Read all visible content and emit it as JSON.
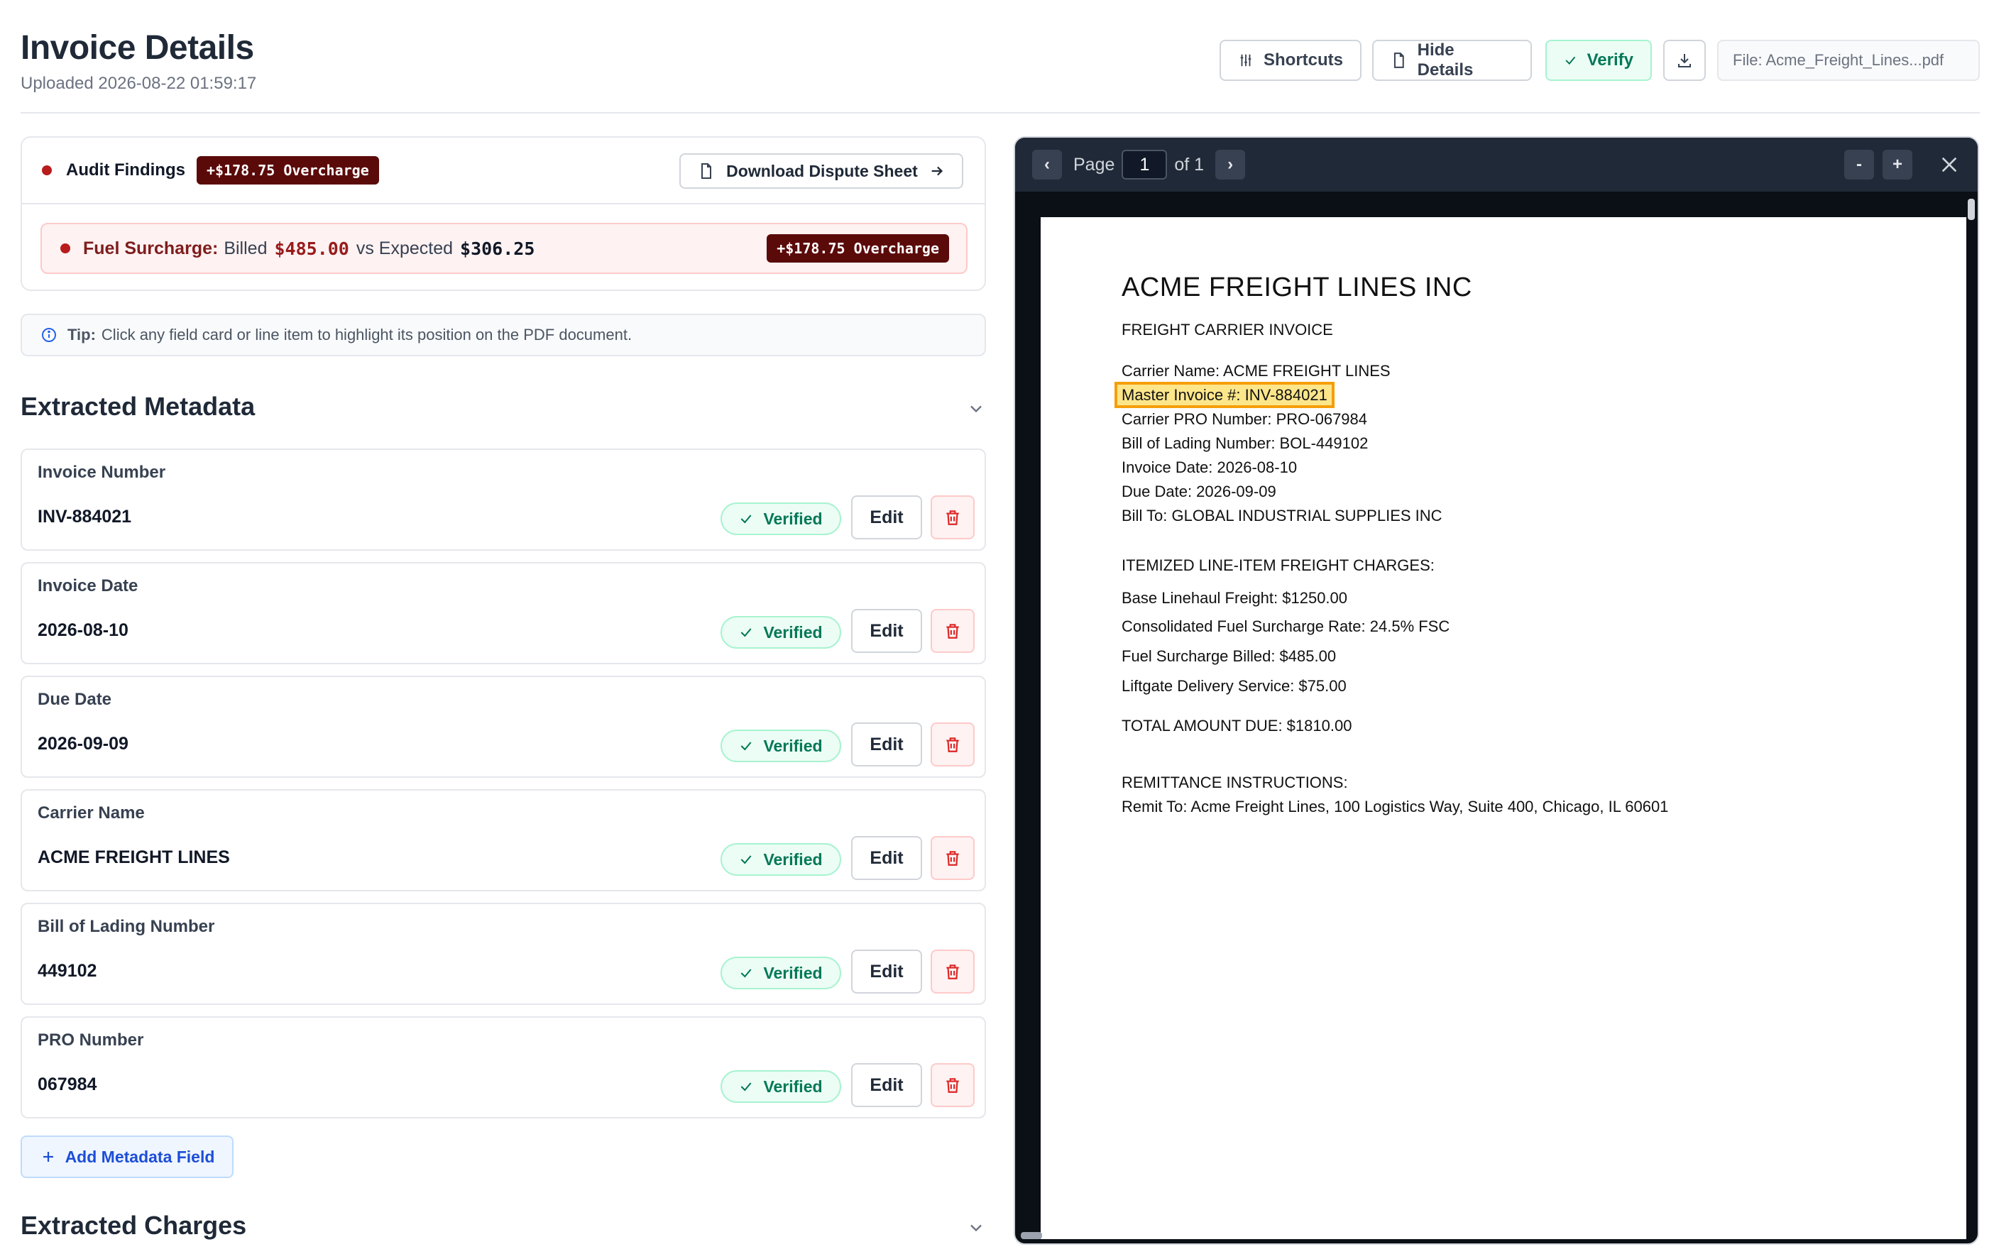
{
  "header": {
    "title": "Invoice Details",
    "uploaded": "Uploaded 2026-08-22 01:59:17",
    "shortcuts_label": "Shortcuts",
    "hide_details_label": "Hide Details",
    "verify_label": "Verify",
    "file_label": "File: Acme_Freight_Lines...pdf"
  },
  "audit": {
    "title": "Audit Findings",
    "badge": "+$178.75 Overcharge",
    "dispute_button": "Download Dispute Sheet",
    "finding": {
      "name": "Fuel Surcharge:",
      "billed_prefix": "Billed",
      "billed": "$485.00",
      "vs_text": "vs Expected",
      "expected": "$306.25",
      "badge": "+$178.75 Overcharge"
    }
  },
  "tip": {
    "strong": "Tip:",
    "text": "Click any field card or line item to highlight its position on the PDF document."
  },
  "metadata": {
    "title": "Extracted Metadata",
    "verified_label": "Verified",
    "edit_label": "Edit",
    "fields": [
      {
        "label": "Invoice Number",
        "value": "INV-884021"
      },
      {
        "label": "Invoice Date",
        "value": "2026-08-10"
      },
      {
        "label": "Due Date",
        "value": "2026-09-09"
      },
      {
        "label": "Carrier Name",
        "value": "ACME FREIGHT LINES"
      },
      {
        "label": "Bill of Lading Number",
        "value": "449102"
      },
      {
        "label": "PRO Number",
        "value": "067984"
      }
    ],
    "add_label": "Add Metadata Field"
  },
  "charges": {
    "title": "Extracted Charges"
  },
  "viewer": {
    "page_label": "Page",
    "page_value": "1",
    "of_label": "of 1",
    "prev": "‹",
    "next": "›",
    "zoom_out": "-",
    "zoom_in": "+"
  },
  "document": {
    "title": "ACME FREIGHT LINES INC",
    "subtitle": "FREIGHT CARRIER INVOICE",
    "lines": [
      "Carrier Name: ACME FREIGHT LINES",
      "Master Invoice #: INV-884021",
      "Carrier PRO Number: PRO-067984",
      "Bill of Lading Number: BOL-449102",
      "Invoice Date: 2026-08-10",
      "Due Date: 2026-09-09",
      "Bill To: GLOBAL INDUSTRIAL SUPPLIES INC"
    ],
    "charges_heading": "ITEMIZED LINE-ITEM FREIGHT CHARGES:",
    "charges": [
      "Base Linehaul Freight: $1250.00",
      "Consolidated Fuel Surcharge Rate: 24.5% FSC",
      "Fuel Surcharge Billed: $485.00",
      "Liftgate Delivery Service: $75.00"
    ],
    "total": "TOTAL AMOUNT DUE: $1810.00",
    "remit_heading": "REMITTANCE INSTRUCTIONS:",
    "remit": "Remit To: Acme Freight Lines, 100 Logistics Way, Suite 400, Chicago, IL 60601"
  },
  "colors": {
    "accent_green": "#047857",
    "overcharge_dark": "#5b0a0a",
    "highlight": "#f59e0b"
  }
}
